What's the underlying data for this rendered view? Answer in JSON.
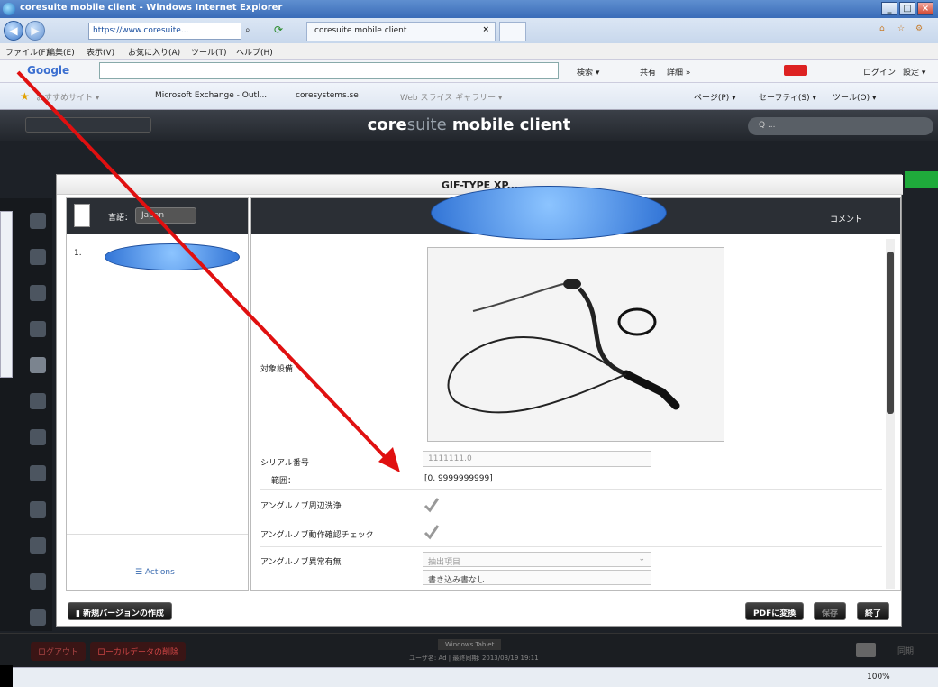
{
  "browser": {
    "window_title": "coresuite mobile client - Windows Internet Explorer",
    "address": "https://www.coresuite...",
    "tab_label": "coresuite mobile client",
    "menu": [
      "ファイル(F)",
      "編集(E)",
      "表示(V)",
      "お気に入り(A)",
      "ツール(T)",
      "ヘルプ(H)"
    ],
    "google_logo": "Google",
    "google_items": [
      "検索 ▾",
      "共有",
      "詳細 »",
      "ログイン",
      "設定 ▾"
    ],
    "favorites": [
      "おすすめサイト ▾",
      "Microsoft Exchange - Outl...",
      "coresystems.se",
      "Web スライス ギャラリー ▾"
    ],
    "right_tools": [
      "ページ(P) ▾",
      "セーフティ(S) ▾",
      "ツール(O) ▾"
    ],
    "zoom": "100%"
  },
  "app": {
    "title_core": "core",
    "title_lite": "suite",
    "title_rest": " mobile client",
    "search_placeholder": "Q  ..."
  },
  "modal": {
    "title": "GIF-TYPE XP...",
    "language_label": "言語：",
    "language_value": "Japan",
    "tree_item": "1.",
    "comment_label": "コメント",
    "image_label": "対象設備",
    "serial_label": "シリアル番号",
    "serial_value": "1111111.0",
    "range_label": "範囲：",
    "range_value": "[0, 9999999999]",
    "angle_clean_label": "アングルノブ周辺洗浄",
    "angle_check_label": "アングルノブ動作確認チェック",
    "angle_abnormal_label": "アングルノブ異常有無",
    "angle_abnormal_value": "抽出項目",
    "note_value": "書き込み書なし",
    "actions_label": "Actions",
    "new_version_button": "新規バージョンの作成",
    "pdf_button": "PDFに変換",
    "save_button": "保存",
    "close_button": "終了"
  },
  "footer": {
    "logout": "ログアウト",
    "local_data": "ローカルデータの削除",
    "center_top": "Windows Tablet",
    "center_bottom": "ユーザ名: Ad | 最終同期: 2013/03/19 19:11",
    "sync": "同期"
  },
  "colors": {
    "arrow": "#e01010",
    "ellipse": "#4a90e2",
    "accent_green": "#1faa3b"
  }
}
